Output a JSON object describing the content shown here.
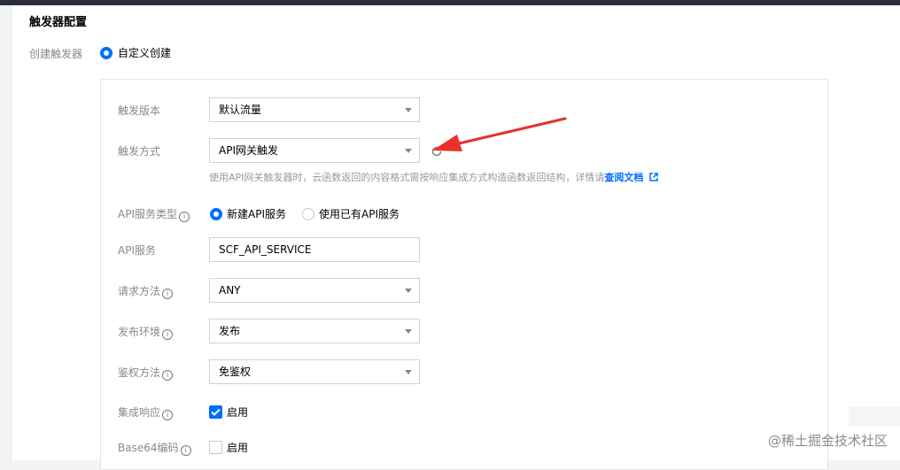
{
  "section": {
    "title": "触发器配置"
  },
  "create_trigger": {
    "label": "创建触发器",
    "option": "自定义创建"
  },
  "trigger_version": {
    "label": "触发版本",
    "value": "默认流量"
  },
  "trigger_method": {
    "label": "触发方式",
    "value": "API网关触发",
    "help_text": "使用API网关触发器时，云函数返回的内容格式需按响应集成方式构造函数返回结构，详情请",
    "help_link": "查阅文档"
  },
  "api_service_type": {
    "label": "API服务类型",
    "option_new": "新建API服务",
    "option_existing": "使用已有API服务"
  },
  "api_service": {
    "label": "API服务",
    "value": "SCF_API_SERVICE"
  },
  "request_method": {
    "label": "请求方法",
    "value": "ANY"
  },
  "publish_env": {
    "label": "发布环境",
    "value": "发布"
  },
  "auth_method": {
    "label": "鉴权方法",
    "value": "免鉴权"
  },
  "integration_response": {
    "label": "集成响应",
    "option": "启用",
    "checked": true
  },
  "base64": {
    "label": "Base64编码",
    "option": "启用",
    "checked": false
  },
  "watermark": "@稀土掘金技术社区",
  "colors": {
    "accent": "#006eff",
    "arrow": "#e8312a"
  }
}
